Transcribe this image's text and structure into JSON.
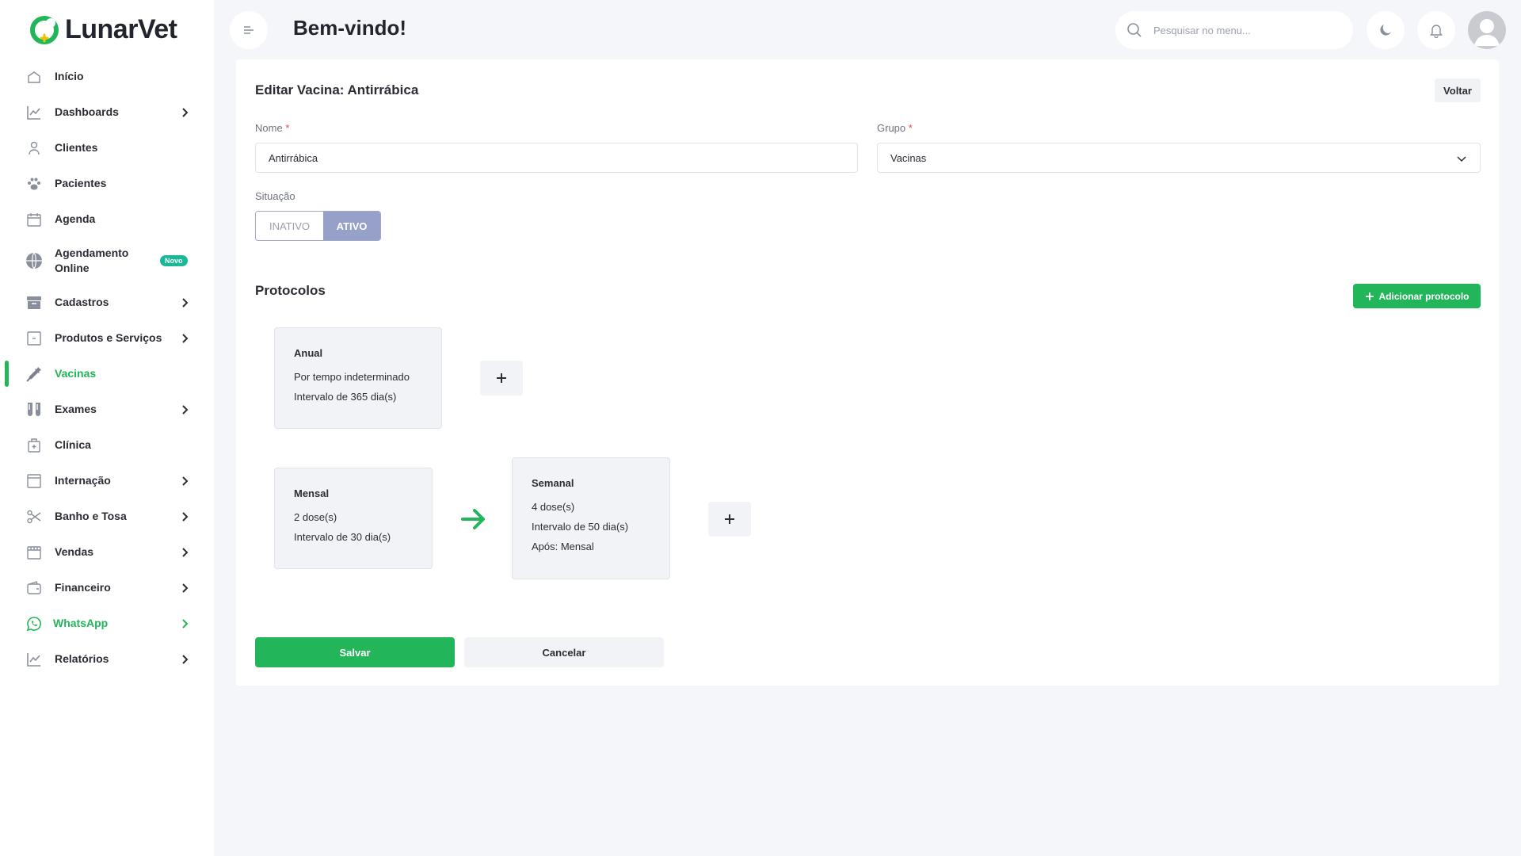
{
  "brand": {
    "name": "LunarVet",
    "color": "#22b559"
  },
  "sidebar": {
    "items": [
      {
        "label": "Início",
        "icon": "home-icon",
        "chevron": false
      },
      {
        "label": "Dashboards",
        "icon": "chart-line-icon",
        "chevron": true
      },
      {
        "label": "Clientes",
        "icon": "user-icon",
        "chevron": false
      },
      {
        "label": "Pacientes",
        "icon": "paw-icon",
        "chevron": false
      },
      {
        "label": "Agenda",
        "icon": "calendar-icon",
        "chevron": false
      },
      {
        "label": "Agendamento Online",
        "icon": "globe-icon",
        "chevron": false,
        "badge": "Novo"
      },
      {
        "label": "Cadastros",
        "icon": "archive-icon",
        "chevron": true
      },
      {
        "label": "Produtos e Serviços",
        "icon": "box-icon",
        "chevron": true
      },
      {
        "label": "Vacinas",
        "icon": "syringe-icon",
        "chevron": false,
        "active": true
      },
      {
        "label": "Exames",
        "icon": "test-tubes-icon",
        "chevron": true
      },
      {
        "label": "Clínica",
        "icon": "clinic-icon",
        "chevron": false
      },
      {
        "label": "Internação",
        "icon": "bed-icon",
        "chevron": true
      },
      {
        "label": "Banho e Tosa",
        "icon": "scissors-icon",
        "chevron": true
      },
      {
        "label": "Vendas",
        "icon": "store-icon",
        "chevron": true
      },
      {
        "label": "Financeiro",
        "icon": "wallet-icon",
        "chevron": true
      },
      {
        "label": "WhatsApp",
        "icon": "whatsapp-icon",
        "chevron": true
      },
      {
        "label": "Relatórios",
        "icon": "report-chart-icon",
        "chevron": true
      }
    ]
  },
  "header": {
    "title": "Bem-vindo!",
    "search_placeholder": "Pesquisar no menu..."
  },
  "form": {
    "title": "Editar Vacina: Antirrábica",
    "back_label": "Voltar",
    "name_label": "Nome",
    "name_value": "Antirrábica",
    "group_label": "Grupo",
    "group_value": "Vacinas",
    "required_mark": "*",
    "status_label": "Situação",
    "status_options": [
      "INATIVO",
      "ATIVO"
    ],
    "status_selected": "ATIVO",
    "status_active_color": "#97a0c8"
  },
  "protocols": {
    "title": "Protocolos",
    "add_label": "Adicionar protocolo",
    "items": [
      {
        "name": "Anual",
        "lines": [
          "Por tempo indeterminado",
          "Intervalo de 365 dia(s)"
        ]
      },
      {
        "name": "Mensal",
        "lines": [
          "2 dose(s)",
          "Intervalo de 30 dia(s)"
        ]
      },
      {
        "name": "Semanal",
        "lines": [
          "4 dose(s)",
          "Intervalo de 50 dia(s)",
          "Após: Mensal"
        ]
      }
    ]
  },
  "actions": {
    "save_label": "Salvar",
    "cancel_label": "Cancelar"
  }
}
